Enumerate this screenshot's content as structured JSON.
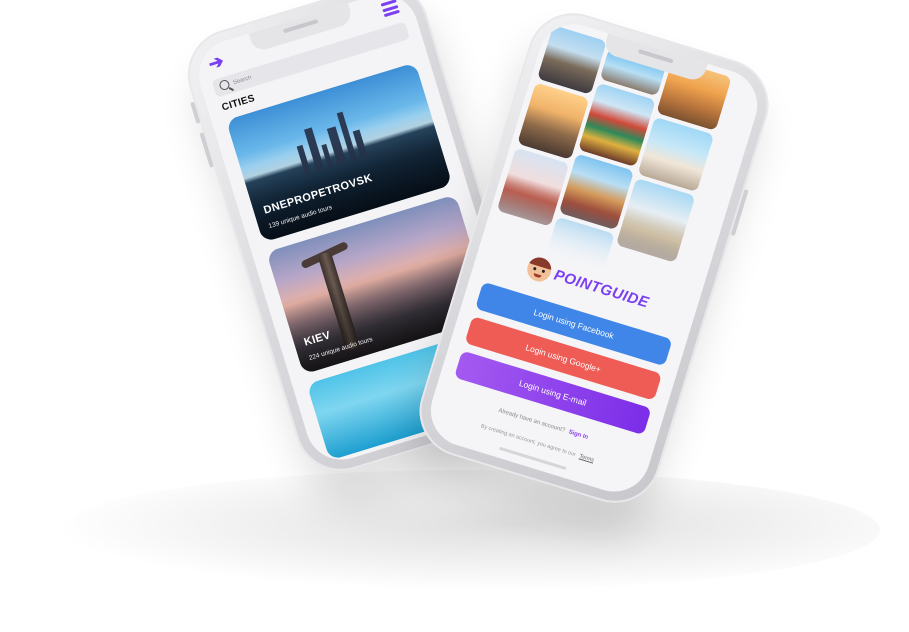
{
  "left_phone": {
    "search": {
      "placeholder": "Search"
    },
    "section_title": "CITIES",
    "cities": [
      {
        "name": "DNEPROPETROVSK",
        "subtitle": "139 unique audio tours"
      },
      {
        "name": "KIEV",
        "subtitle": "224 unique audio tours"
      },
      {
        "name": "",
        "subtitle": ""
      }
    ]
  },
  "right_phone": {
    "brand": "POINTGUIDE",
    "buttons": {
      "facebook": "Login using Facebook",
      "google": "Login using Google+",
      "email": "Login using E-mail"
    },
    "account_prompt": "Already have an account?",
    "sign_in": "Sign In",
    "terms_prefix": "By creating an account, you agree to our",
    "terms_link": "Terms"
  },
  "colors": {
    "accent": "#7b3ff2",
    "facebook": "#3f86e8",
    "google": "#ef5b55",
    "email": "#8a3ff0"
  },
  "icons": [
    "back-arrow-icon",
    "hamburger-menu-icon",
    "search-icon"
  ]
}
